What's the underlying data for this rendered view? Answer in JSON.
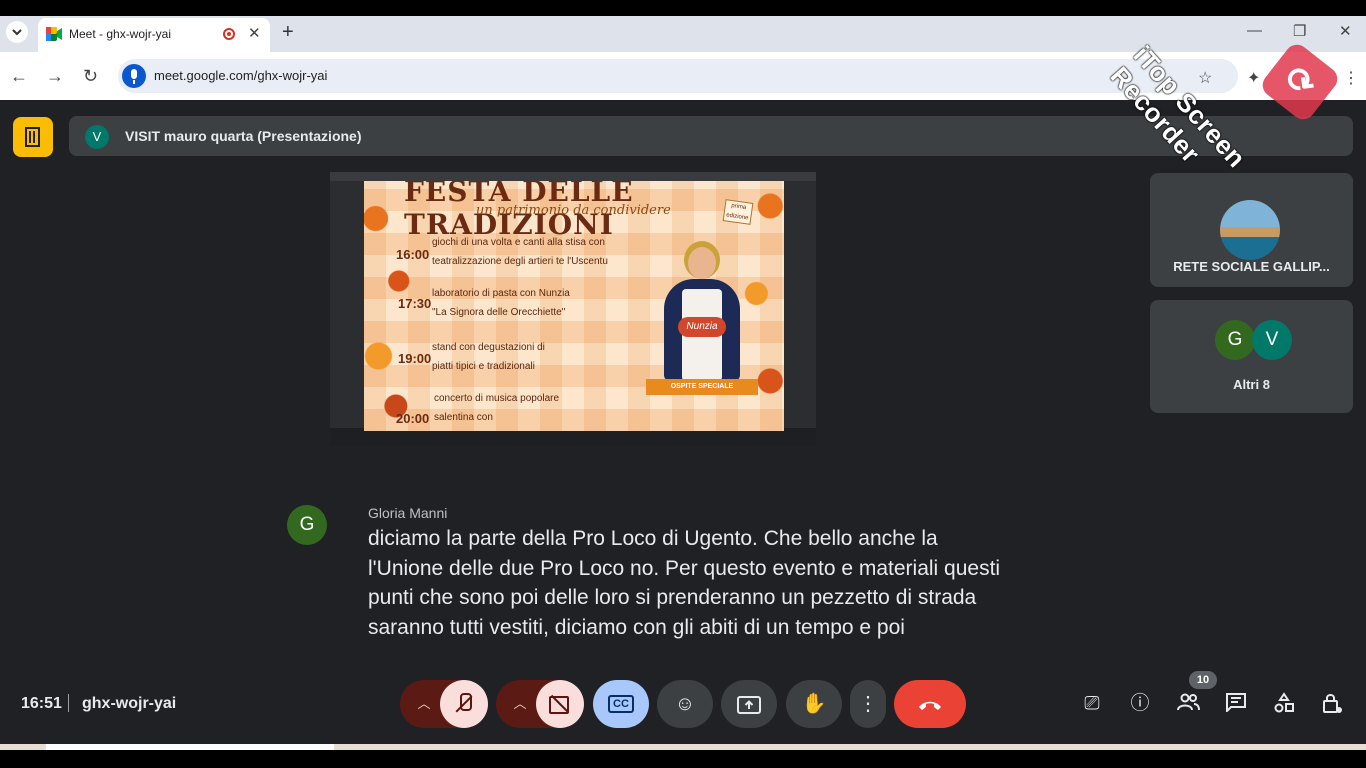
{
  "browser": {
    "tab_title": "Meet - ghx-wojr-yai",
    "tab_close": "✕",
    "new_tab": "+",
    "url": "meet.google.com/ghx-wojr-yai",
    "window_controls": [
      "—",
      "❐",
      "✕"
    ]
  },
  "meet": {
    "presentation_banner": "VISIT mauro quarta (Presentazione)",
    "presenter_initial": "V",
    "tiles": [
      {
        "name": "RETE SOCIALE GALLIP..."
      },
      {
        "initials": [
          "G",
          "V"
        ],
        "name": "Altri 8"
      }
    ],
    "caption": {
      "initial": "G",
      "speaker": "Gloria Manni",
      "lines": [
        "diciamo la parte della Pro Loco di Ugento. Che bello anche la",
        "l'Unione delle due Pro Loco no. Per questo evento e materiali questi",
        "punti che sono poi delle loro si prenderanno un pezzetto di strada",
        "saranno tutti vestiti, diciamo con gli abiti di un tempo e poi"
      ]
    },
    "bottom": {
      "time": "16:51",
      "meeting_code": "ghx-wojr-yai",
      "cc_label": "CC",
      "participants_count": "10"
    }
  },
  "poster": {
    "title": "FESTA DELLE TRADIZIONI",
    "subtitle": "un patrimonio da condividere",
    "stamp": "prima edizione",
    "schedule": [
      {
        "time": "16:00",
        "lines": [
          "giochi di una volta e canti alla stisa con",
          "teatralizzazione degli artieri te l'Uscentu"
        ]
      },
      {
        "time": "17:30",
        "lines": [
          "laboratorio di pasta con Nunzia",
          "\"La Signora delle Orecchiette\""
        ]
      },
      {
        "time": "19:00",
        "lines": [
          "stand con degustazioni di",
          "piatti tipici e tradizionali"
        ]
      },
      {
        "time": "20:00",
        "lines": [
          "concerto di musica popolare",
          "salentina con"
        ]
      }
    ],
    "guest_tag": "Nunzia",
    "guest_ribbon": "OSPITE SPECIALE"
  },
  "watermark": {
    "text": "iTop Screen Recorder"
  },
  "colors": {
    "meet_background": "#202124",
    "surface": "#3c4043",
    "presentation_button": "#fbbc04",
    "end_call": "#ea4335",
    "captions_active": "#a8c7fa"
  },
  "icons": [
    "chevron-down-icon",
    "meet-favicon-icon",
    "recording-icon",
    "close-icon",
    "back-icon",
    "forward-icon",
    "reload-icon",
    "voice-search-icon",
    "star-icon",
    "extensions-icon",
    "menu-dots-icon",
    "present-icon",
    "mic-off-icon",
    "camera-off-icon",
    "captions-icon",
    "emoji-icon",
    "present-screen-icon",
    "raise-hand-icon",
    "more-options-icon",
    "end-call-icon",
    "no-presentation-icon",
    "info-icon",
    "people-icon",
    "chat-icon",
    "activities-icon",
    "host-controls-icon"
  ]
}
